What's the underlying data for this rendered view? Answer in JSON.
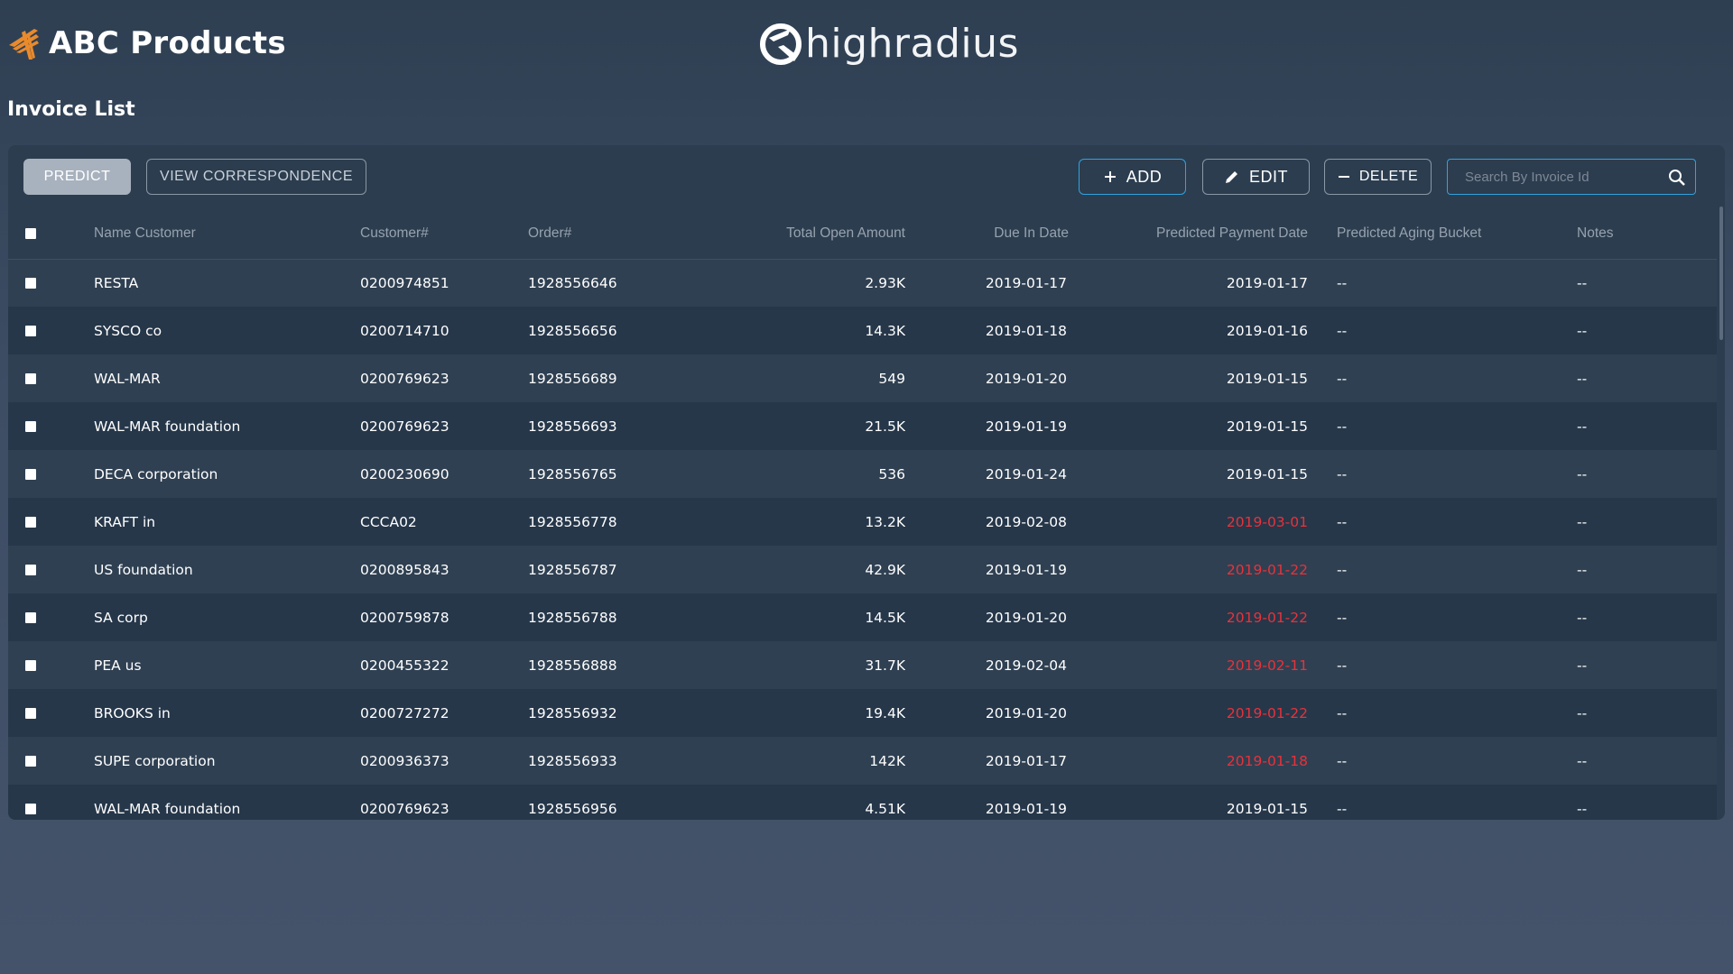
{
  "header": {
    "company_name": "ABC Products",
    "partner_logo_text": "highradius",
    "page_title": "Invoice List"
  },
  "toolbar": {
    "predict_label": "PREDICT",
    "correspondence_label": "VIEW CORRESPONDENCE",
    "add_label": "ADD",
    "edit_label": "EDIT",
    "delete_label": "DELETE",
    "search_placeholder": "Search By Invoice Id",
    "search_value": ""
  },
  "table": {
    "columns": [
      "Name Customer",
      "Customer#",
      "Order#",
      "Total Open Amount",
      "Due In Date",
      "Predicted Payment Date",
      "Predicted Aging Bucket",
      "Notes"
    ],
    "rows": [
      {
        "name": "RESTA",
        "customer": "0200974851",
        "order": "1928556646",
        "amount": "2.93K",
        "due": "2019-01-17",
        "predicted": "2019-01-17",
        "late": false,
        "bucket": "--",
        "notes": "--"
      },
      {
        "name": "SYSCO co",
        "customer": "0200714710",
        "order": "1928556656",
        "amount": "14.3K",
        "due": "2019-01-18",
        "predicted": "2019-01-16",
        "late": false,
        "bucket": "--",
        "notes": "--"
      },
      {
        "name": "WAL-MAR",
        "customer": "0200769623",
        "order": "1928556689",
        "amount": "549",
        "due": "2019-01-20",
        "predicted": "2019-01-15",
        "late": false,
        "bucket": "--",
        "notes": "--"
      },
      {
        "name": "WAL-MAR foundation",
        "customer": "0200769623",
        "order": "1928556693",
        "amount": "21.5K",
        "due": "2019-01-19",
        "predicted": "2019-01-15",
        "late": false,
        "bucket": "--",
        "notes": "--"
      },
      {
        "name": "DECA corporation",
        "customer": "0200230690",
        "order": "1928556765",
        "amount": "536",
        "due": "2019-01-24",
        "predicted": "2019-01-15",
        "late": false,
        "bucket": "--",
        "notes": "--"
      },
      {
        "name": "KRAFT in",
        "customer": "CCCA02",
        "order": "1928556778",
        "amount": "13.2K",
        "due": "2019-02-08",
        "predicted": "2019-03-01",
        "late": true,
        "bucket": "--",
        "notes": "--"
      },
      {
        "name": "US foundation",
        "customer": "0200895843",
        "order": "1928556787",
        "amount": "42.9K",
        "due": "2019-01-19",
        "predicted": "2019-01-22",
        "late": true,
        "bucket": "--",
        "notes": "--"
      },
      {
        "name": "SA corp",
        "customer": "0200759878",
        "order": "1928556788",
        "amount": "14.5K",
        "due": "2019-01-20",
        "predicted": "2019-01-22",
        "late": true,
        "bucket": "--",
        "notes": "--"
      },
      {
        "name": "PEA us",
        "customer": "0200455322",
        "order": "1928556888",
        "amount": "31.7K",
        "due": "2019-02-04",
        "predicted": "2019-02-11",
        "late": true,
        "bucket": "--",
        "notes": "--"
      },
      {
        "name": "BROOKS in",
        "customer": "0200727272",
        "order": "1928556932",
        "amount": "19.4K",
        "due": "2019-01-20",
        "predicted": "2019-01-22",
        "late": true,
        "bucket": "--",
        "notes": "--"
      },
      {
        "name": "SUPE corporation",
        "customer": "0200936373",
        "order": "1928556933",
        "amount": "142K",
        "due": "2019-01-17",
        "predicted": "2019-01-18",
        "late": true,
        "bucket": "--",
        "notes": "--"
      },
      {
        "name": "WAL-MAR foundation",
        "customer": "0200769623",
        "order": "1928556956",
        "amount": "4.51K",
        "due": "2019-01-19",
        "predicted": "2019-01-15",
        "late": false,
        "bucket": "--",
        "notes": "--"
      }
    ]
  },
  "icons": {
    "brand": "abc-bird-logo-icon",
    "partner": "highradius-logo-icon",
    "add": "plus-icon",
    "edit": "pencil-icon",
    "delete": "minus-icon",
    "search": "search-icon",
    "checkbox": "checkbox-icon"
  },
  "colors": {
    "accent": "#2fa3de",
    "late_date": "#e8323a",
    "brand_logo": "#e98a2c"
  }
}
